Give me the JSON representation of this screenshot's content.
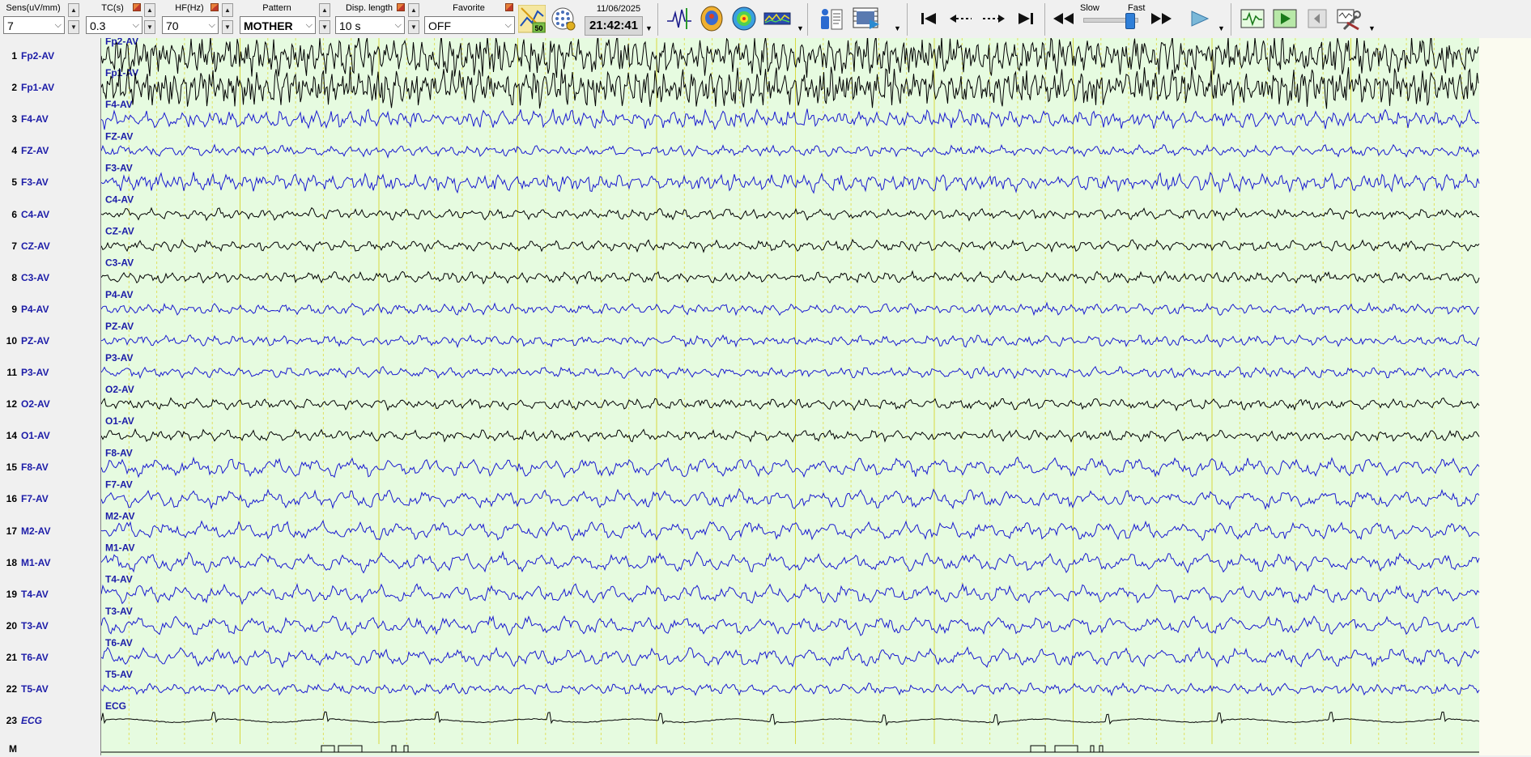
{
  "toolbar": {
    "sensitivity": {
      "label": "Sens(uV/mm)",
      "value": "7"
    },
    "time_constant": {
      "label": "TC(s)",
      "value": "0.3"
    },
    "high_filter": {
      "label": "HF(Hz)",
      "value": "70"
    },
    "pattern": {
      "label": "Pattern",
      "value": "MOTHER"
    },
    "display_length": {
      "label": "Disp. length",
      "value": "10 s"
    },
    "favorite": {
      "label": "Favorite",
      "value": "OFF"
    },
    "notch_badge": "50",
    "date": "11/06/2025",
    "time": "21:42:41",
    "speed": {
      "slow_label": "Slow",
      "fast_label": "Fast"
    },
    "icons": {
      "notch": "notch-filter-icon",
      "montage": "electrode-montage-icon",
      "waveform": "waveform-marker-icon",
      "head_map": "head-map-icon",
      "topo_map": "topographic-map-icon",
      "spectrum": "spectrum-icon",
      "patient": "patient-info-icon",
      "video": "video-icon",
      "first": "skip-to-start-icon",
      "prev_page": "page-back-icon",
      "next_page": "page-forward-icon",
      "last": "skip-to-end-icon",
      "rewind": "fast-rewind-icon",
      "forward": "fast-forward-icon",
      "play": "play-icon",
      "trend": "trend-view-icon",
      "review": "review-icon",
      "hide_panel": "hide-panel-icon",
      "tools": "tools-icon"
    }
  },
  "channels": [
    {
      "num": "1",
      "name": "Fp2-AV",
      "trace_label": "Fp2-AV",
      "color": "#000000"
    },
    {
      "num": "2",
      "name": "Fp1-AV",
      "trace_label": "Fp1-AV",
      "color": "#000000"
    },
    {
      "num": "3",
      "name": "F4-AV",
      "trace_label": "F4-AV",
      "color": "#1a1ad0"
    },
    {
      "num": "4",
      "name": "FZ-AV",
      "trace_label": "FZ-AV",
      "color": "#1a1ad0"
    },
    {
      "num": "5",
      "name": "F3-AV",
      "trace_label": "F3-AV",
      "color": "#1a1ad0"
    },
    {
      "num": "6",
      "name": "C4-AV",
      "trace_label": "C4-AV",
      "color": "#000000"
    },
    {
      "num": "7",
      "name": "CZ-AV",
      "trace_label": "CZ-AV",
      "color": "#000000"
    },
    {
      "num": "8",
      "name": "C3-AV",
      "trace_label": "C3-AV",
      "color": "#000000"
    },
    {
      "num": "9",
      "name": "P4-AV",
      "trace_label": "P4-AV",
      "color": "#1a1ad0"
    },
    {
      "num": "10",
      "name": "PZ-AV",
      "trace_label": "PZ-AV",
      "color": "#1a1ad0"
    },
    {
      "num": "11",
      "name": "P3-AV",
      "trace_label": "P3-AV",
      "color": "#1a1ad0"
    },
    {
      "num": "12",
      "name": "O2-AV",
      "trace_label": "O2-AV",
      "color": "#000000"
    },
    {
      "num": "14",
      "name": "O1-AV",
      "trace_label": "O1-AV",
      "color": "#000000"
    },
    {
      "num": "15",
      "name": "F8-AV",
      "trace_label": "F8-AV",
      "color": "#1a1ad0"
    },
    {
      "num": "16",
      "name": "F7-AV",
      "trace_label": "F7-AV",
      "color": "#1a1ad0"
    },
    {
      "num": "17",
      "name": "M2-AV",
      "trace_label": "M2-AV",
      "color": "#1a1ad0"
    },
    {
      "num": "18",
      "name": "M1-AV",
      "trace_label": "M1-AV",
      "color": "#1a1ad0"
    },
    {
      "num": "19",
      "name": "T4-AV",
      "trace_label": "T4-AV",
      "color": "#1a1ad0"
    },
    {
      "num": "20",
      "name": "T3-AV",
      "trace_label": "T3-AV",
      "color": "#1a1ad0"
    },
    {
      "num": "21",
      "name": "T6-AV",
      "trace_label": "T6-AV",
      "color": "#1a1ad0"
    },
    {
      "num": "22",
      "name": "T5-AV",
      "trace_label": "T5-AV",
      "color": "#1a1ad0"
    },
    {
      "num": "23",
      "name": "ECG",
      "trace_label": "ECG",
      "color": "#000000"
    }
  ],
  "marker_row": {
    "label": "M"
  },
  "colors": {
    "trace_background": "#e6fbe0",
    "grid_line": "#e0e060",
    "channel_label": "#1c1ca8",
    "eeg_blue": "#1a1ad0",
    "eeg_black": "#000000"
  }
}
